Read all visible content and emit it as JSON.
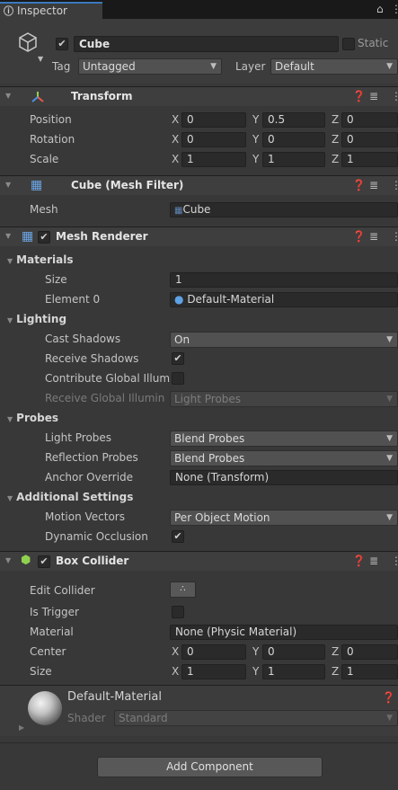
{
  "tab": {
    "title": "Inspector",
    "info_icon": "info-icon",
    "lock_icon": "lock-icon",
    "menu_icon": "kebab-menu-icon"
  },
  "object": {
    "name": "Cube",
    "active": true,
    "static_label": "Static",
    "tag_label": "Tag",
    "tag_value": "Untagged",
    "layer_label": "Layer",
    "layer_value": "Default"
  },
  "transform": {
    "title": "Transform",
    "rows": [
      {
        "label": "Position",
        "x": "0",
        "y": "0.5",
        "z": "0"
      },
      {
        "label": "Rotation",
        "x": "0",
        "y": "0",
        "z": "0"
      },
      {
        "label": "Scale",
        "x": "1",
        "y": "1",
        "z": "1"
      }
    ],
    "axis_x": "X",
    "axis_y": "Y",
    "axis_z": "Z"
  },
  "mesh_filter": {
    "title": "Cube (Mesh Filter)",
    "mesh_label": "Mesh",
    "mesh_value": "Cube"
  },
  "mesh_renderer": {
    "title": "Mesh Renderer",
    "materials_label": "Materials",
    "size_label": "Size",
    "size_value": "1",
    "element0_label": "Element 0",
    "element0_value": "Default-Material",
    "lighting_label": "Lighting",
    "cast_shadows_label": "Cast Shadows",
    "cast_shadows_value": "On",
    "receive_shadows_label": "Receive Shadows",
    "contribute_gi_label": "Contribute Global Illum",
    "receive_gi_label": "Receive Global Illumin",
    "receive_gi_value": "Light Probes",
    "probes_label": "Probes",
    "light_probes_label": "Light Probes",
    "light_probes_value": "Blend Probes",
    "reflection_probes_label": "Reflection Probes",
    "reflection_probes_value": "Blend Probes",
    "anchor_override_label": "Anchor Override",
    "anchor_override_value": "None (Transform)",
    "additional_label": "Additional Settings",
    "motion_vectors_label": "Motion Vectors",
    "motion_vectors_value": "Per Object Motion",
    "dynamic_occlusion_label": "Dynamic Occlusion"
  },
  "box_collider": {
    "title": "Box Collider",
    "edit_collider_label": "Edit Collider",
    "is_trigger_label": "Is Trigger",
    "material_label": "Material",
    "material_value": "None (Physic Material)",
    "center_label": "Center",
    "center": {
      "x": "0",
      "y": "0",
      "z": "0"
    },
    "size_label": "Size",
    "size": {
      "x": "1",
      "y": "1",
      "z": "1"
    }
  },
  "material_preview": {
    "name": "Default-Material",
    "shader_label": "Shader",
    "shader_value": "Standard"
  },
  "add_component_label": "Add Component",
  "colors": {
    "accent": "#3a79bb",
    "background": "#383838",
    "header": "#3e3e3e",
    "field": "#2a2a2a"
  }
}
